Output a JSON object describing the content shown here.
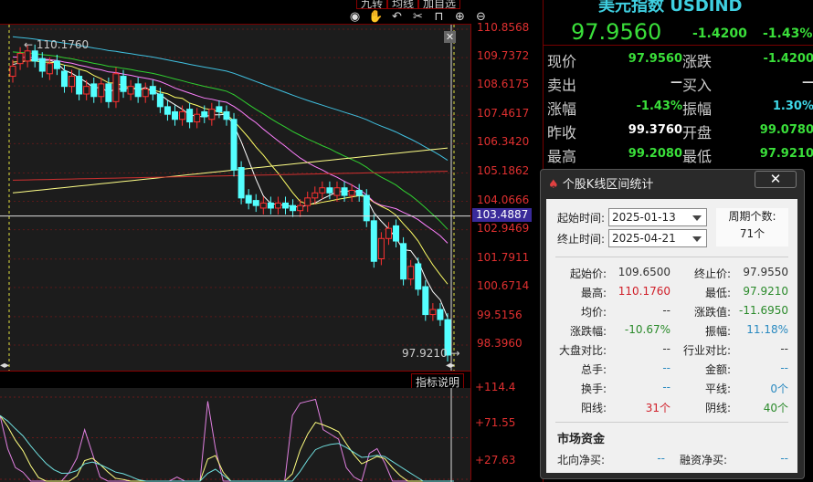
{
  "toolbar": {
    "tabs": [
      "九转",
      "均线",
      "加自选"
    ],
    "icons": [
      "eye-icon",
      "hand-icon",
      "undo-icon",
      "scissors-icon",
      "lock-icon",
      "zoom-in-icon",
      "zoom-out-icon"
    ]
  },
  "quote": {
    "title": "美元指数 USDIND",
    "price": "97.9560",
    "change": "-1.4200",
    "change_pct": "-1.43%",
    "rows": [
      {
        "l1": "现价",
        "v1": "97.9560",
        "c1": "#3adf3a",
        "l2": "涨跌",
        "v2": "-1.4200",
        "c2": "#3adf3a"
      },
      {
        "l1": "卖出",
        "v1": "—",
        "c1": "#ddd",
        "l2": "买入",
        "v2": "—",
        "c2": "#ddd"
      },
      {
        "l1": "涨幅",
        "v1": "-1.43%",
        "c1": "#3adf3a",
        "l2": "振幅",
        "v2": "1.30%",
        "c2": "#3fd8e8"
      },
      {
        "l1": "昨收",
        "v1": "99.3760",
        "c1": "#fff",
        "l2": "开盘",
        "v2": "99.0780",
        "c2": "#3adf3a"
      },
      {
        "l1": "最高",
        "v1": "99.2080",
        "c1": "#3adf3a",
        "l2": "最低",
        "v2": "97.9210",
        "c2": "#3adf3a"
      }
    ]
  },
  "chart": {
    "price_axis": [
      "110.8568",
      "109.7372",
      "108.6175",
      "107.4617",
      "106.3420",
      "105.1862",
      "104.0666",
      "102.9469",
      "101.7911",
      "100.6714",
      "99.5156",
      "98.3960"
    ],
    "crosshair_price": "103.4887",
    "high_marker": "110.1760",
    "low_marker": "97.9210",
    "indicator_button": "指标说明",
    "sub_axis": [
      "+114.4",
      "+71.55",
      "+27.63"
    ],
    "colors": {
      "up": "#ff3232",
      "down": "#54ffff"
    },
    "closes": [
      109.4,
      109.9,
      110.0,
      109.6,
      109.2,
      109.5,
      109.3,
      108.6,
      109.0,
      108.3,
      108.6,
      108.2,
      108.7,
      108.0,
      109.1,
      108.4,
      108.6,
      108.2,
      108.5,
      108.3,
      107.8,
      107.5,
      107.3,
      107.6,
      107.2,
      107.5,
      107.4,
      107.7,
      107.6,
      107.3,
      105.3,
      104.2,
      104.0,
      103.9,
      104.0,
      103.8,
      104.0,
      103.8,
      103.7,
      103.9,
      104.2,
      104.4,
      104.6,
      104.4,
      104.6,
      104.3,
      104.5,
      104.3,
      103.3,
      101.7,
      102.6,
      103.0,
      102.5,
      101.0,
      101.5,
      100.6,
      99.6,
      99.8,
      99.4,
      98.0
    ],
    "opens": [
      109.0,
      109.5,
      109.6,
      110.0,
      109.7,
      109.1,
      109.6,
      109.2,
      108.6,
      109.0,
      108.3,
      108.7,
      108.2,
      108.7,
      108.0,
      109.0,
      108.3,
      108.7,
      108.2,
      108.6,
      108.3,
      107.8,
      107.6,
      107.3,
      107.7,
      107.2,
      107.6,
      107.3,
      107.8,
      107.6,
      107.3,
      105.4,
      104.3,
      104.1,
      103.8,
      104.0,
      103.8,
      104.0,
      103.9,
      103.7,
      103.9,
      104.2,
      104.4,
      104.6,
      104.3,
      104.6,
      104.3,
      104.5,
      104.3,
      103.3,
      101.8,
      102.6,
      103.1,
      102.4,
      101.0,
      101.6,
      100.7,
      99.6,
      99.8,
      99.4
    ],
    "sub_values": [
      95,
      60,
      40,
      35,
      10,
      5,
      0,
      5,
      15,
      35,
      50,
      80,
      55,
      30,
      20,
      15,
      25,
      15,
      10,
      5,
      0,
      -5,
      15,
      30,
      20,
      22,
      18,
      110,
      60,
      0,
      -10,
      -20,
      -15,
      -5,
      5,
      10,
      5,
      0,
      95,
      108,
      110,
      112,
      80,
      75,
      70,
      40,
      30,
      25,
      55,
      60,
      45,
      20,
      15,
      10,
      5,
      0,
      -5,
      -10,
      -15,
      -20
    ]
  },
  "dialog": {
    "title": "个股K线区间统计",
    "close": "✕",
    "start_label": "起始时间:",
    "start": "2025-01-13",
    "end_label": "终止时间:",
    "end": "2025-04-21",
    "period_label": "周期个数:",
    "period": "71个",
    "stats": [
      {
        "l1": "起始价:",
        "v1": "109.6500",
        "c1": "#333",
        "l2": "终止价:",
        "v2": "97.9550",
        "c2": "#333"
      },
      {
        "l1": "最高:",
        "v1": "110.1760",
        "c1": "#d0202a",
        "l2": "最低:",
        "v2": "97.9210",
        "c2": "#2a8a2a"
      },
      {
        "l1": "均价:",
        "v1": "--",
        "c1": "#333",
        "l2": "涨跌值:",
        "v2": "-11.6950",
        "c2": "#2a8a2a"
      },
      {
        "l1": "涨跌幅:",
        "v1": "-10.67%",
        "c1": "#2a8a2a",
        "l2": "振幅:",
        "v2": "11.18%",
        "c2": "#2a8ac0"
      },
      {
        "l1": "大盘对比:",
        "v1": "--",
        "c1": "#333",
        "l2": "行业对比:",
        "v2": "--",
        "c2": "#333"
      },
      {
        "l1": "总手:",
        "v1": "--",
        "c1": "#2a8ac0",
        "l2": "金额:",
        "v2": "--",
        "c2": "#2a8ac0"
      },
      {
        "l1": "换手:",
        "v1": "--",
        "c1": "#2a8ac0",
        "l2": "平线:",
        "v2": "0个",
        "c2": "#2a8ac0"
      },
      {
        "l1": "阳线:",
        "v1": "31个",
        "c1": "#d0202a",
        "l2": "阴线:",
        "v2": "40个",
        "c2": "#2a8a2a"
      }
    ],
    "funds_title": "市场资金",
    "north_label": "北向净买:",
    "north": "--",
    "margin_label": "融资净买:",
    "margin": "--"
  }
}
